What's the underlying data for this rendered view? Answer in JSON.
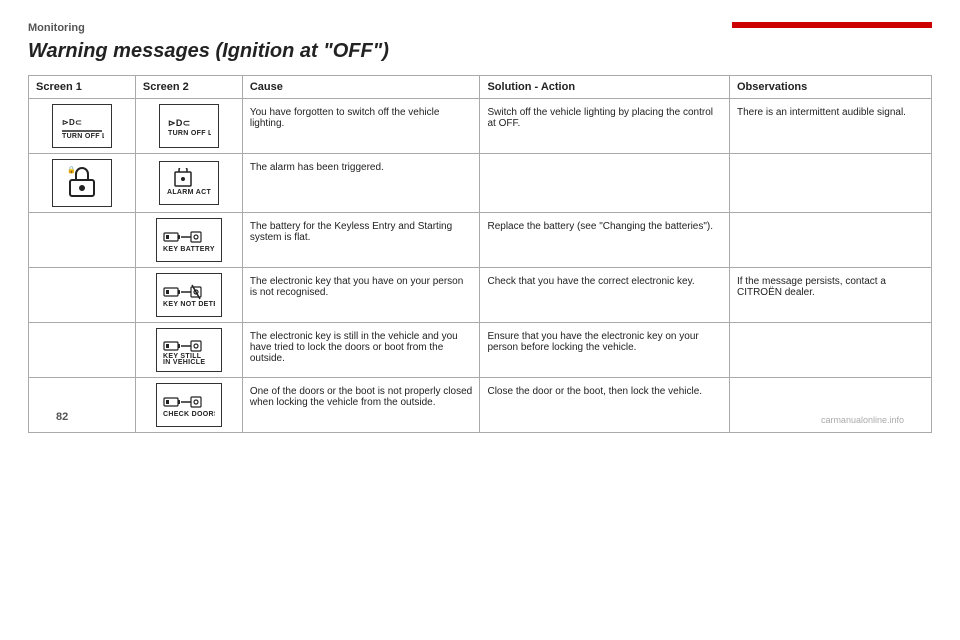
{
  "section": "Monitoring",
  "title": "Warning messages (Ignition at \"OFF\")",
  "table": {
    "headers": [
      "Screen 1",
      "Screen 2",
      "Cause",
      "Solution - Action",
      "Observations"
    ],
    "rows": [
      {
        "screen1_label": "TURN OFF LIGHTS",
        "screen1_icon": "turn_off_lights_1",
        "screen2_label": "TURN OFF LIGHTS",
        "screen2_icon": "turn_off_lights_2",
        "cause": "You have forgotten to switch off the vehicle lighting.",
        "solution": "Switch off the vehicle lighting by placing the control at OFF.",
        "observation": "There is an intermittent audible signal."
      },
      {
        "screen1_label": "",
        "screen1_icon": "alarm_lock",
        "screen2_label": "ALARM ACTIVATING",
        "screen2_icon": "alarm_activating",
        "cause": "The alarm has been triggered.",
        "solution": "",
        "observation": ""
      },
      {
        "screen1_label": "",
        "screen1_icon": "",
        "screen2_label": "KEY BATTERY LOW",
        "screen2_icon": "key_battery_low",
        "cause": "The battery for the Keyless Entry and Starting system is flat.",
        "solution": "Replace the battery (see \"Changing the batteries\").",
        "observation": ""
      },
      {
        "screen1_label": "",
        "screen1_icon": "",
        "screen2_label": "KEY NOT DETECTED",
        "screen2_icon": "key_not_detected",
        "cause": "The electronic key that you have on your person is not recognised.",
        "solution": "Check that you have the correct electronic key.",
        "observation": "If the message persists, contact a CITROËN dealer."
      },
      {
        "screen1_label": "",
        "screen1_icon": "",
        "screen2_label": "KEY STILL\nIN VEHICLE",
        "screen2_icon": "key_still_in_vehicle",
        "cause": "The electronic key is still in the vehicle and you have tried to lock the doors or boot from the outside.",
        "solution": "Ensure that you have the electronic key on your person before locking the vehicle.",
        "observation": ""
      },
      {
        "screen1_label": "",
        "screen1_icon": "",
        "screen2_label": "CHECK DOORS",
        "screen2_icon": "check_doors",
        "cause": "One of the doors or the boot is not properly closed when locking the vehicle from the outside.",
        "solution": "Close the door or the boot, then lock the vehicle.",
        "observation": ""
      }
    ]
  },
  "page_number": "82"
}
